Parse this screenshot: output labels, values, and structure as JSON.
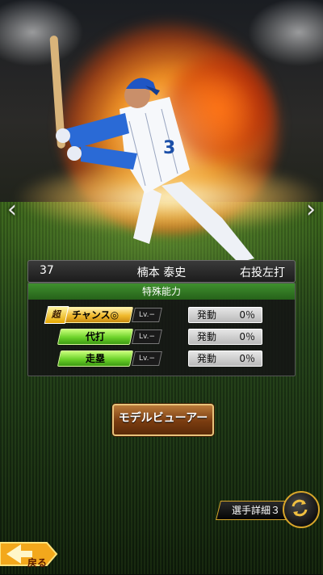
{
  "player": {
    "number": "37",
    "name": "楠本 泰史",
    "batting_hand": "右投左打"
  },
  "abilities": {
    "header": "特殊能力",
    "items": [
      {
        "prefix": "超",
        "name": "チャンス◎",
        "tier": "gold",
        "level": "Lv.−",
        "status": "発動",
        "percent": "0％"
      },
      {
        "prefix": "",
        "name": "代打",
        "tier": "green",
        "level": "Lv.−",
        "status": "発動",
        "percent": "0％"
      },
      {
        "prefix": "",
        "name": "走塁",
        "tier": "green",
        "level": "Lv.−",
        "status": "発動",
        "percent": "0％"
      }
    ]
  },
  "buttons": {
    "model_viewer": "モデルビューアー",
    "player_detail": "選手詳細３",
    "back": "戻る"
  },
  "icons": {
    "prev": "chevron-left-icon",
    "next": "chevron-right-icon",
    "swap": "swap-arrows-icon",
    "back": "back-arrow-icon"
  },
  "colors": {
    "ability_header": "#3f8f2e",
    "gold_skill": "#f0b92c",
    "green_skill": "#6cd22a",
    "button_border": "#d8a62a"
  }
}
